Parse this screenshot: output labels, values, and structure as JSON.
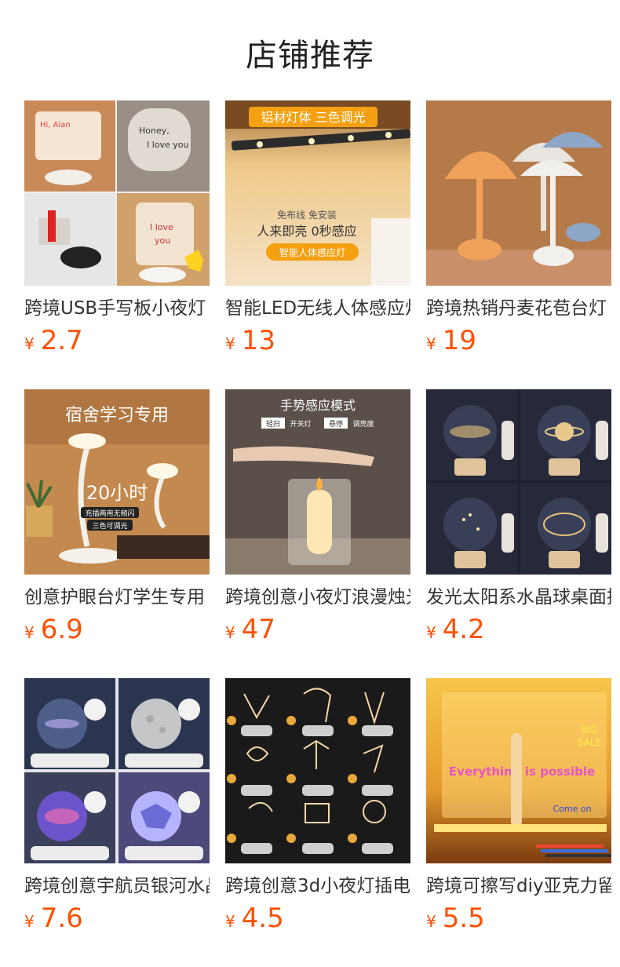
{
  "page": {
    "title": "店铺推荐"
  },
  "currency_symbol": "¥",
  "products": [
    {
      "name": "跨境USB手写板小夜灯",
      "price": "2.7",
      "image_text": {
        "note1": "Hi, Alan",
        "note2": "Honey, I love you",
        "note3": "I love you"
      }
    },
    {
      "name": "智能LED无线人体感应灯",
      "price": "13",
      "image_text": {
        "badge": "铝材灯体  三色调光",
        "sub": "免布线 免安装",
        "main": "人来即亮 0秒感应",
        "pill": "智能人体感应灯"
      }
    },
    {
      "name": "跨境热销丹麦花苞台灯",
      "price": "19",
      "image_text": {}
    },
    {
      "name": "创意护眼台灯学生专用",
      "price": "6.9",
      "image_text": {
        "banner": "宿舍学习专用",
        "hours": "20小时",
        "tag1": "充插两用无频闪",
        "tag2": "三色可调光"
      }
    },
    {
      "name": "跨境创意小夜灯浪漫烛光",
      "price": "47",
      "image_text": {
        "head": "手势感应模式",
        "l1": "轻扫",
        "l2": "开关灯",
        "l3": "悬停",
        "l4": "调亮度"
      }
    },
    {
      "name": "发光太阳系水晶球桌面摆件",
      "price": "4.2",
      "image_text": {}
    },
    {
      "name": "跨境创意宇航员银河水晶球",
      "price": "7.6",
      "image_text": {}
    },
    {
      "name": "跨境创意3d小夜灯插电",
      "price": "4.5",
      "image_text": {}
    },
    {
      "name": "跨境可擦写diy亚克力留言板",
      "price": "5.5",
      "image_text": {
        "big": "BIG",
        "sale": "SALE",
        "main": "Everything is possible",
        "come": "Come on"
      }
    }
  ],
  "colors": {
    "price": "#ff5000",
    "title": "#222222"
  }
}
